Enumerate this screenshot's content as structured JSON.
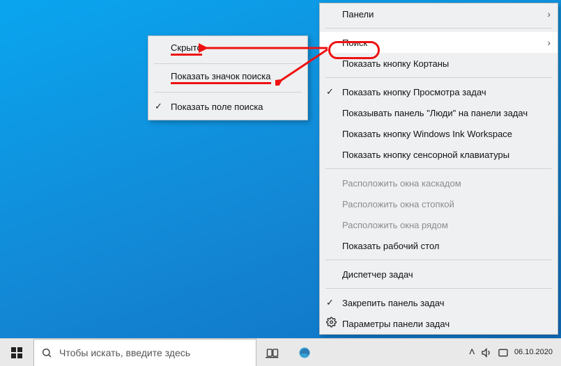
{
  "taskbar": {
    "search_placeholder": "Чтобы искать, введите здесь",
    "clock_time": "",
    "clock_date": "06.10.2020"
  },
  "sub_menu": {
    "hidden": "Скрыто",
    "show_search_icon": "Показать значок поиска",
    "show_search_box": "Показать поле поиска"
  },
  "main_menu": {
    "panels": "Панели",
    "search": "Поиск",
    "show_cortana": "Показать кнопку Кортаны",
    "show_taskview": "Показать кнопку Просмотра задач",
    "show_people": "Показывать панель \"Люди\" на панели задач",
    "show_ink": "Показать кнопку Windows Ink Workspace",
    "show_touchkb": "Показать кнопку сенсорной клавиатуры",
    "cascade": "Расположить окна каскадом",
    "stack": "Расположить окна стопкой",
    "sidebyside": "Расположить окна рядом",
    "show_desktop": "Показать рабочий стол",
    "task_manager": "Диспетчер задач",
    "lock_taskbar": "Закрепить панель задач",
    "taskbar_settings": "Параметры панели задач"
  }
}
